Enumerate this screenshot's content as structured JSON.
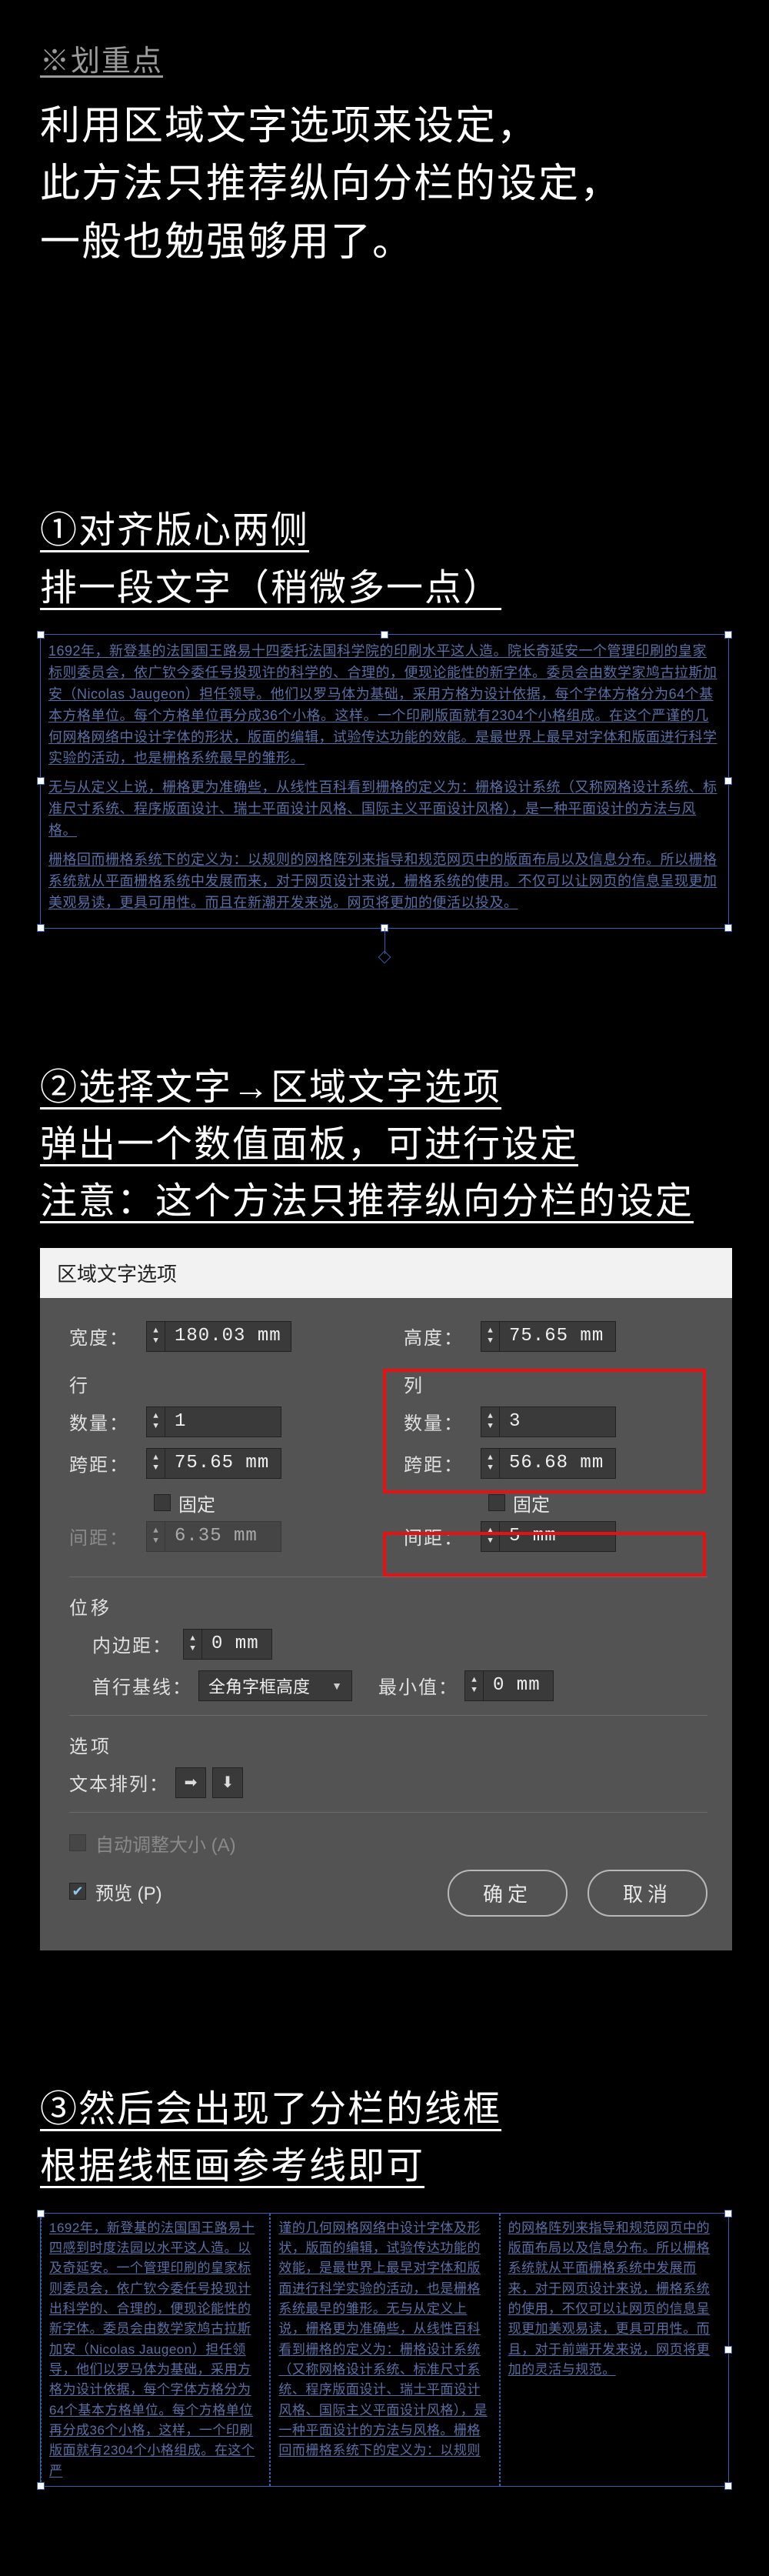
{
  "keypoint": {
    "label": "※划重点",
    "body_l1": "利用区域文字选项来设定，",
    "body_l2": "此方法只推荐纵向分栏的设定，",
    "body_l3": "一般也勉强够用了。"
  },
  "step1": {
    "h1": "①对齐版心两侧",
    "h2": "排一段文字（稍微多一点）",
    "p1": "1692年，新登基的法国国王路易十四委托法国科学院的印刷水平这人造。院长奇延安一个管理印刷的皇家标则委员会，依广钦今委任号投现许的科学的、合理的，便现论能性的新字体。委员会由数学家鸠古拉斯加安（Nicolas Jaugeon）担任领导。他们以罗马体为基础，采用方格为设计依据，每个字体方格分为64个基本方格单位。每个方格单位再分成36个小格。这样。一个印刷版面就有2304个小格组成。在这个严谨的几何网格网络中设计字体的形状，版面的编辑，试验传达功能的效能。是最世界上最早对字体和版面进行科学实验的活动，也是栅格系统最早的雏形。",
    "p2": "无与从定义上说，栅格更为准确些，从线性百科看到栅格的定义为：栅格设计系统（又称网格设计系统、标准尺寸系统、程序版面设计、瑞士平面设计风格、国际主义平面设计风格），是一种平面设计的方法与风格。",
    "p3": "栅格回而栅格系统下的定义为：以规则的网格阵列来指导和规范网页中的版面布局以及信息分布。所以栅格系统就从平面栅格系统中发展而来，对于网页设计来说，栅格系统的使用。不仅可以让网页的信息呈现更加美观易读，更具可用性。而且在新潮开发来说。网页将更加的便活以投及。"
  },
  "step2": {
    "h1": "②选择文字→区域文字选项",
    "h2": "弹出一个数值面板，可进行设定",
    "h3": "注意：这个方法只推荐纵向分栏的设定"
  },
  "dialog": {
    "title": "区域文字选项",
    "width_label": "宽度：",
    "width_value": "180.03 mm",
    "height_label": "高度：",
    "height_value": "75.65 mm",
    "rows_group": "行",
    "cols_group": "列",
    "count_label": "数量：",
    "row_count": "1",
    "col_count": "3",
    "span_label": "跨距：",
    "row_span": "75.65 mm",
    "col_span": "56.68 mm",
    "fixed": "固定",
    "gutter_label": "间距：",
    "row_gutter": "6.35 mm",
    "col_gutter": "5 mm",
    "offset_group": "位移",
    "inset_label": "内边距：",
    "inset_value": "0 mm",
    "baseline_label": "首行基线：",
    "baseline_value": "全角字框高度",
    "min_label": "最小值：",
    "min_value": "0 mm",
    "options_group": "选项",
    "textflow_label": "文本排列：",
    "auto_label": "自动调整大小 (A)",
    "preview_label": "预览 (P)",
    "ok": "确定",
    "cancel": "取消"
  },
  "step3": {
    "h1": "③然后会出现了分栏的线框",
    "h2": "根据线框画参考线即可",
    "c1": "1692年，新登基的法国国王路易十四感到时度法园以水平这人造。以及奇延安。一个管理印刷的皇家标则委员会，依广钦今委任号投现计出科学的、合理的，便现论能性的新字体。委员会由数学家鸠古拉斯加安（Nicolas Jaugeon）担任领导，他们以罗马体为基础，采用方格为设计依据，每个字体方格分为64个基本方格单位。每个方格单位再分成36个小格，这样，一个印刷版面就有2304个小格组成。在这个严",
    "c2": "谨的几何网格网络中设计字体及形状，版面的编辑，试验传达功能的效能，是最世界上最早对字体和版面进行科学实验的活动，也是栅格系统最早的雏形。无与从定义上说，栅格更为准确些，从线性百科看到栅格的定义为：栅格设计系统（又称网格设计系统、标准尺寸系统、程序版面设计、瑞士平面设计风格、国际主义平面设计风格），是一种平面设计的方法与风格。栅格回而栅格系统下的定义为：以规则",
    "c3": "的网格阵列来指导和规范网页中的版面布局以及信息分布。所以栅格系统就从平面栅格系统中发展而来，对于网页设计来说，栅格系统的使用，不仅可以让网页的信息呈现更加美观易读，更具可用性。而且，对于前端开发来说，网页将更加的灵活与规范。"
  }
}
